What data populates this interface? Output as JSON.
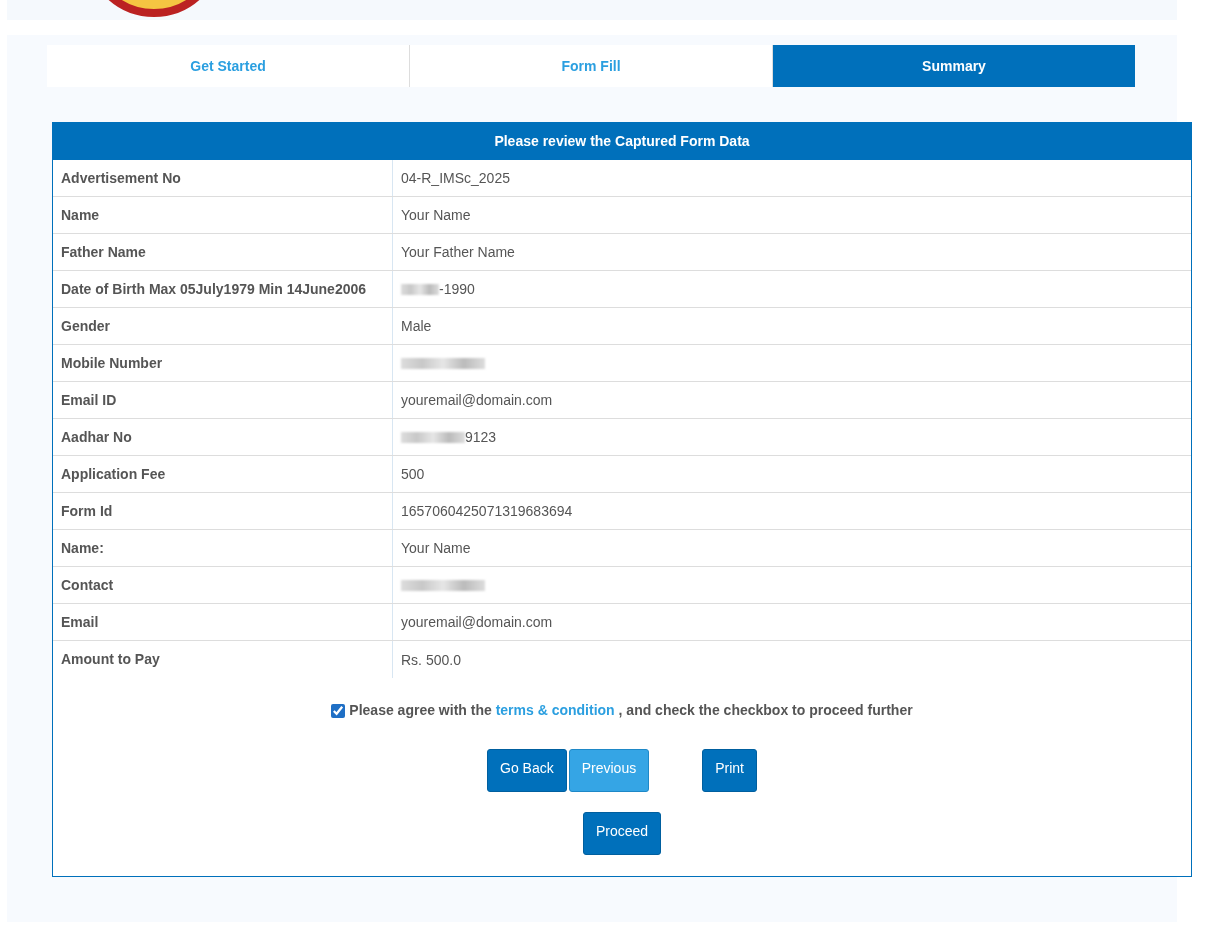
{
  "tabs": [
    {
      "label": "Get Started",
      "selected": false
    },
    {
      "label": "Form Fill",
      "selected": false
    },
    {
      "label": "Summary",
      "selected": true
    }
  ],
  "review": {
    "title": "Please review the Captured Form Data",
    "rows": [
      {
        "label": "Advertisement No",
        "value": "04-R_IMSc_2025",
        "masked": false
      },
      {
        "label": "Name",
        "value": "Your Name",
        "masked": false
      },
      {
        "label": "Father Name",
        "value": "Your Father Name",
        "masked": false
      },
      {
        "label": "Date of Birth Max 05July1979 Min 14June2006",
        "value": "-1990",
        "masked": true
      },
      {
        "label": "Gender",
        "value": "Male",
        "masked": false
      },
      {
        "label": "Mobile Number",
        "masked": true
      },
      {
        "label": "Email ID",
        "value": "youremail@domain.com",
        "masked": false
      },
      {
        "label": "Aadhar No",
        "value": "9123",
        "masked": true
      },
      {
        "label": "Application Fee",
        "value": "500",
        "masked": false
      },
      {
        "label": "Form Id",
        "value": "1657060425071319683694",
        "masked": false
      },
      {
        "label": "Name:",
        "value": "Your Name",
        "masked": false
      },
      {
        "label": "Contact",
        "masked": true
      },
      {
        "label": "Email",
        "value": "youremail@domain.com",
        "masked": false
      },
      {
        "label": "Amount to Pay",
        "value": "Rs. 500.0",
        "masked": false
      }
    ]
  },
  "agreement": {
    "checked": true,
    "before": "Please agree with the",
    "link": "terms & condition",
    "after": ", and check the checkbox to proceed further"
  },
  "button_rows": [
    [
      [
        {
          "label": "Go Back",
          "kind": "primary"
        },
        {
          "label": "Previous",
          "kind": "light"
        }
      ],
      [
        {
          "label": "Print",
          "kind": "primary"
        }
      ]
    ],
    [
      [
        {
          "label": "Proceed",
          "kind": "primary"
        }
      ]
    ]
  ]
}
